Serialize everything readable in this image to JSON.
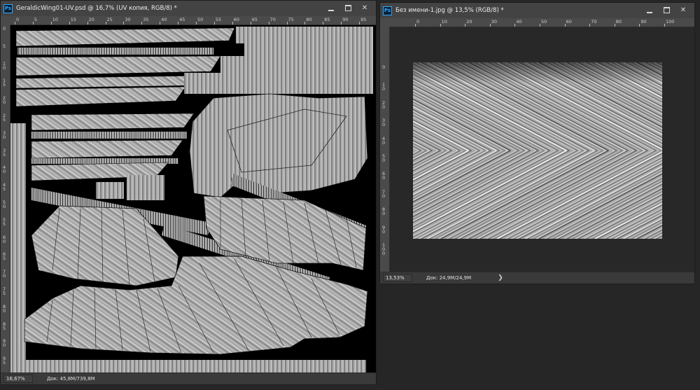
{
  "win1": {
    "title": "GeraldicWing01-UV.psd @ 16,7% (UV копия, RGB/8) *",
    "zoom": "16,67%",
    "doc": "Док: 45,8M/739,8M",
    "ruler_x": [
      "0",
      "5",
      "10",
      "15",
      "20",
      "25",
      "30",
      "35",
      "40",
      "45",
      "50",
      "55",
      "60",
      "65",
      "70",
      "75",
      "80",
      "85",
      "90",
      "95"
    ],
    "ruler_y": [
      "0",
      "5",
      "1\n0",
      "1\n5",
      "2\n0",
      "2\n5",
      "3\n0",
      "3\n5",
      "4\n0",
      "4\n5",
      "5\n0",
      "5\n5",
      "6\n0",
      "6\n5",
      "7\n0",
      "7\n5",
      "8\n0",
      "8\n5",
      "9\n0",
      "9\n5"
    ]
  },
  "win2": {
    "title": "Без имени-1.jpg @ 13,5% (RGB/8) *",
    "zoom": "13,53%",
    "doc": "Док: 24,9M/24,9M",
    "ruler_x": [
      "0",
      "10",
      "20",
      "30",
      "40",
      "50",
      "60",
      "70",
      "80",
      "90",
      "100"
    ],
    "ruler_y": [
      "0",
      "1\n0",
      "2\n0",
      "3\n0",
      "4\n0",
      "5\n0",
      "6\n0",
      "7\n0",
      "8\n0",
      "9\n0",
      "1\n0\n0"
    ]
  },
  "ps_label": "Ps",
  "status_arrow": "❯"
}
